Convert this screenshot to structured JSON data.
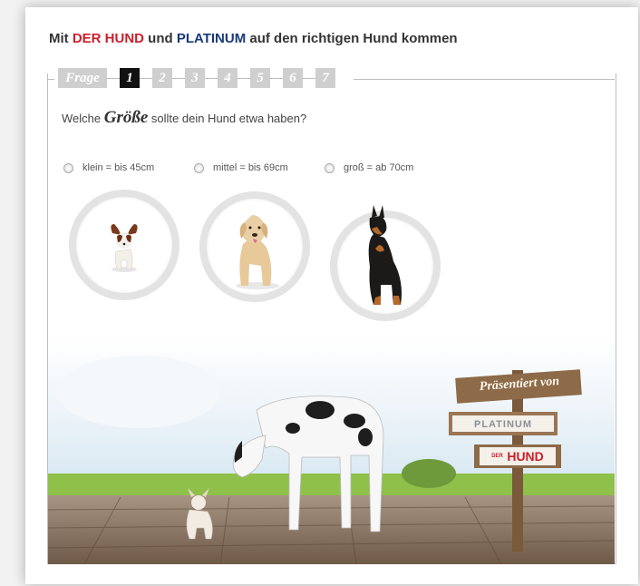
{
  "header": {
    "title_prefix": "Mit ",
    "brand1": "DER HUND",
    "title_mid": " und ",
    "brand2": "PLATINUM",
    "title_suffix": " auf den richtigen Hund kommen"
  },
  "steps": {
    "frage_label": "Frage",
    "items": [
      "1",
      "2",
      "3",
      "4",
      "5",
      "6",
      "7"
    ],
    "active_index": 0
  },
  "question": {
    "prefix": "Welche ",
    "accent": "Größe",
    "suffix": " sollte dein Hund etwa haben?"
  },
  "options": [
    {
      "label": "klein = bis 45cm",
      "image": "small-dog-papillon"
    },
    {
      "label": "mittel = bis 69cm",
      "image": "medium-dog-labrador"
    },
    {
      "label": "groß = ab 70cm",
      "image": "large-dog-doberman"
    }
  ],
  "sign": {
    "line1": "Präsentiert von",
    "line2": "PLATINUM",
    "line3": "HUND",
    "line3_prefix": "DER"
  },
  "colors": {
    "brand_red": "#cc1f2b",
    "brand_blue": "#173a7a",
    "step_inactive": "#cfcfcf",
    "step_active": "#111111"
  }
}
